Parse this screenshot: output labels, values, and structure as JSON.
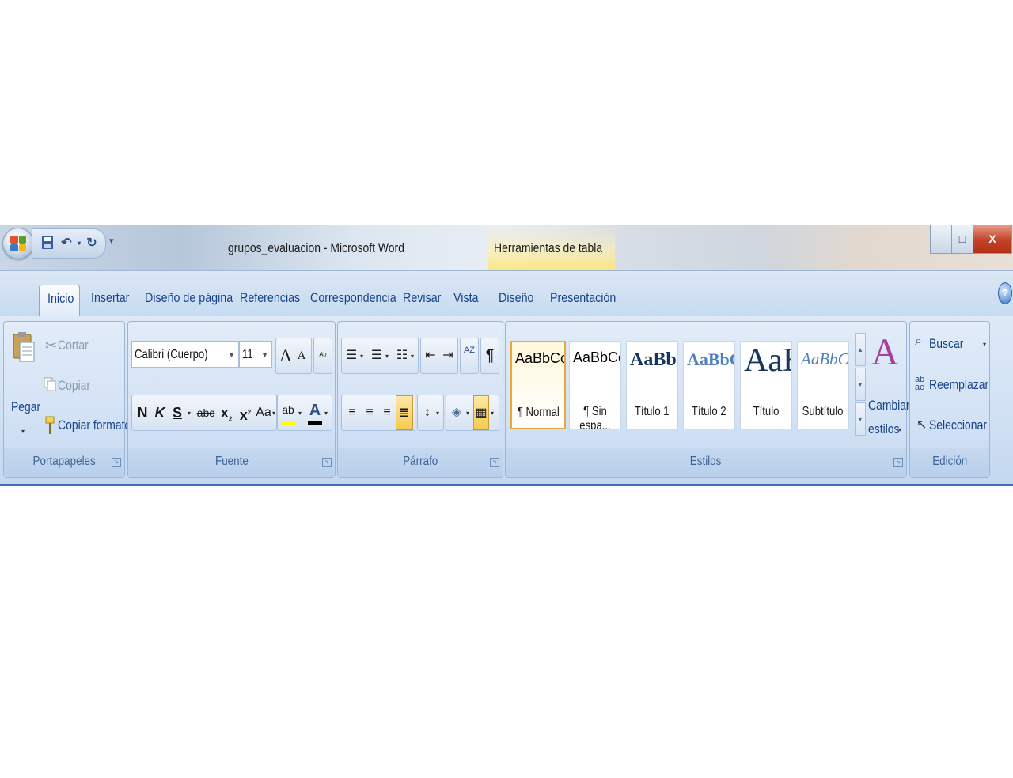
{
  "titlebar": {
    "document_title": "grupos_evaluacion - Microsoft Word",
    "context_tab_label": "Herramientas de tabla",
    "qat_icons": [
      "save-icon",
      "undo-icon",
      "redo-icon"
    ],
    "window_buttons": {
      "minimize": "–",
      "restore": "□",
      "close": "X"
    }
  },
  "tabs": [
    {
      "label": "Inicio",
      "active": true
    },
    {
      "label": "Insertar"
    },
    {
      "label": "Diseño de página"
    },
    {
      "label": "Referencias"
    },
    {
      "label": "Correspondencia"
    },
    {
      "label": "Revisar"
    },
    {
      "label": "Vista"
    },
    {
      "label": "Diseño"
    },
    {
      "label": "Presentación"
    }
  ],
  "help": "?",
  "clipboard": {
    "group_label": "Portapapeles",
    "paste": "Pegar",
    "cut": "Cortar",
    "copy": "Copiar",
    "format_painter": "Copiar formato"
  },
  "font": {
    "group_label": "Fuente",
    "font_name": "Calibri (Cuerpo)",
    "font_size": "11",
    "bold": "N",
    "italic": "K",
    "underline": "S",
    "strikethrough": "abc",
    "subscript": "x",
    "superscript": "x",
    "change_case": "Aa",
    "grow": "A",
    "shrink": "A",
    "highlight": "ab",
    "font_color": "A",
    "font_color_hex": "#000000",
    "highlight_hex": "#ffff00"
  },
  "paragraph": {
    "group_label": "Párrafo",
    "sort": "AZ",
    "pilcrow": "¶",
    "active_alignment": "justify"
  },
  "styles": {
    "group_label": "Estilos",
    "items": [
      {
        "sample": "AaBbCcDc",
        "name": "¶ Normal",
        "selected": true
      },
      {
        "sample": "AaBbCcDc",
        "name": "¶ Sin espa..."
      },
      {
        "sample": "AaBbC(",
        "name": "Título 1"
      },
      {
        "sample": "AaBbCc",
        "name": "Título 2"
      },
      {
        "sample": "AaB",
        "name": "Título"
      },
      {
        "sample": "AaBbCc.",
        "name": "Subtítulo"
      }
    ],
    "change_styles_line1": "Cambiar",
    "change_styles_line2": "estilos"
  },
  "editing": {
    "group_label": "Edición",
    "find": "Buscar",
    "replace": "Reemplazar",
    "select": "Seleccionar"
  }
}
